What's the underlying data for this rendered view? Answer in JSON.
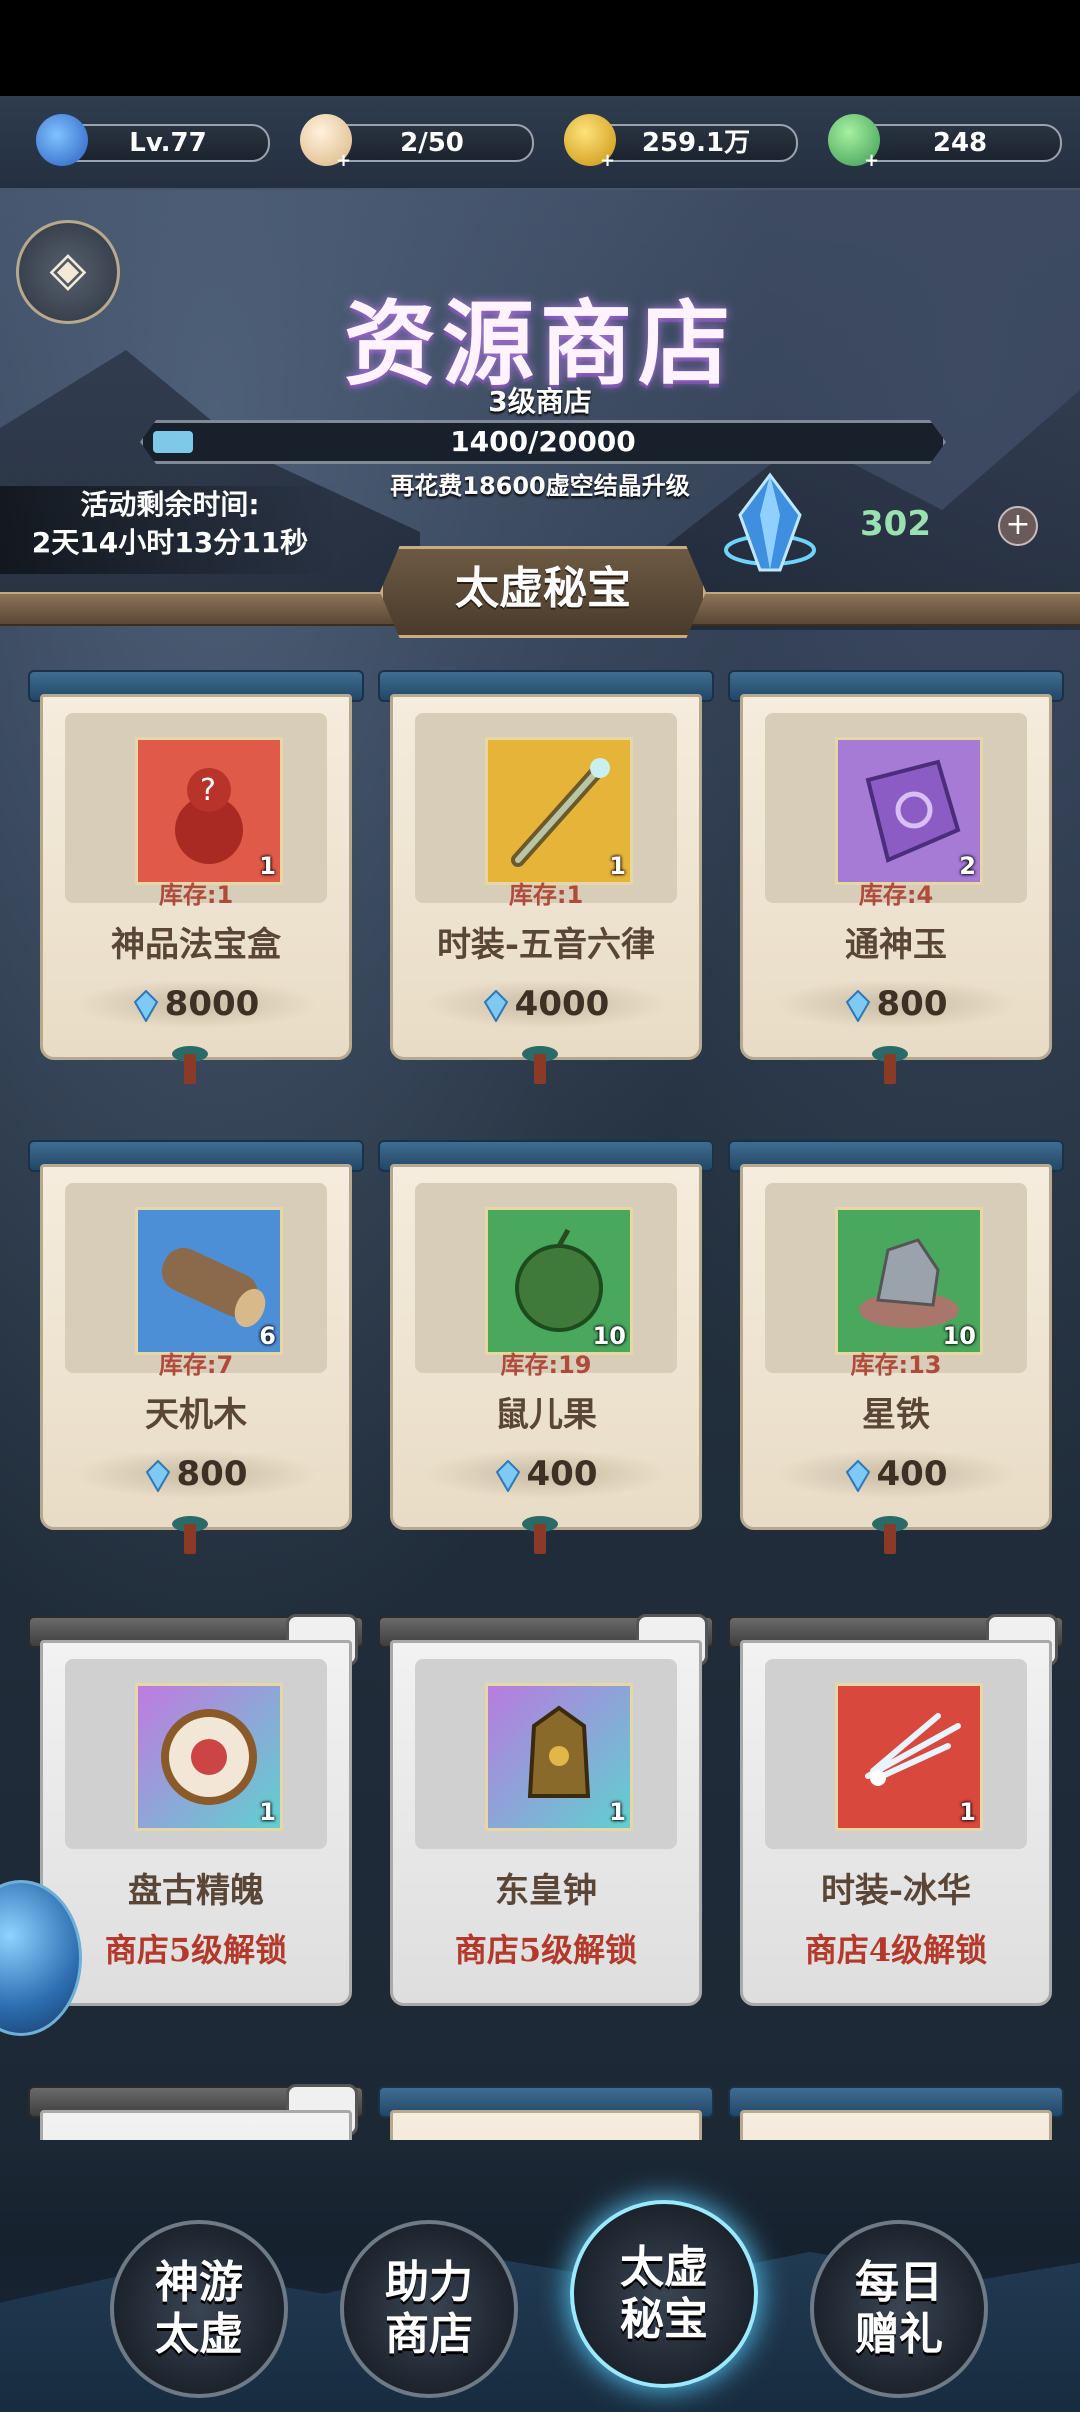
{
  "resources": [
    {
      "icon": "level-swirl-icon",
      "value": "Lv.77",
      "color": "#3a7bd5",
      "plus": false
    },
    {
      "icon": "steamed-bun-icon",
      "value": "2/50",
      "color": "#e8c9a0",
      "plus": true
    },
    {
      "icon": "gold-coin-icon",
      "value": "259.1万",
      "color": "#d9a21a",
      "plus": true
    },
    {
      "icon": "green-leaf-icon",
      "value": "248",
      "color": "#4fb36a",
      "plus": true
    }
  ],
  "header": {
    "title": "资源商店",
    "level": "3级商店",
    "exp": "1400/20000",
    "exp_progress": 0.07,
    "upgrade_hint": "再花费18600虚空结晶升级",
    "timer_label": "活动剩余时间:",
    "timer_value": "2天14小时13分11秒",
    "currency_amount": "302",
    "currency_plus": "+",
    "section_tab": "太虚秘宝",
    "back_icon": "back-arrow-icon"
  },
  "items": [
    {
      "name": "神品法宝盒",
      "stock": "库存:1",
      "qty": "1",
      "price": "8000",
      "bg": "#e05a4a",
      "icon": "gourd-icon",
      "locked": false
    },
    {
      "name": "时装-五音六律",
      "stock": "库存:1",
      "qty": "1",
      "price": "4000",
      "bg": "#e7b43a",
      "icon": "flute-icon",
      "locked": false
    },
    {
      "name": "通神玉",
      "stock": "库存:4",
      "qty": "2",
      "price": "800",
      "bg": "#a57bd6",
      "icon": "jade-stone-icon",
      "locked": false
    },
    {
      "name": "天机木",
      "stock": "库存:7",
      "qty": "6",
      "price": "800",
      "bg": "#4d8fd6",
      "icon": "wood-log-icon",
      "locked": false
    },
    {
      "name": "鼠儿果",
      "stock": "库存:19",
      "qty": "10",
      "price": "400",
      "bg": "#49a85e",
      "icon": "green-fruit-icon",
      "locked": false
    },
    {
      "name": "星铁",
      "stock": "库存:13",
      "qty": "10",
      "price": "400",
      "bg": "#49a85e",
      "icon": "star-iron-ore-icon",
      "locked": false
    },
    {
      "name": "盘古精魄",
      "qty": "1",
      "unlock": "商店5级解锁",
      "bg": "#c07ae0",
      "icon": "pangu-spirit-icon",
      "locked": true
    },
    {
      "name": "东皇钟",
      "qty": "1",
      "unlock": "商店5级解锁",
      "bg": "#b87be0",
      "icon": "bell-icon",
      "locked": true
    },
    {
      "name": "时装-冰华",
      "qty": "1",
      "unlock": "商店4级解锁",
      "bg": "#d9483d",
      "icon": "ice-feather-icon",
      "locked": true
    }
  ],
  "nav": [
    {
      "label_line1": "神游",
      "label_line2": "太虚",
      "active": false
    },
    {
      "label_line1": "助力",
      "label_line2": "商店",
      "active": false
    },
    {
      "label_line1": "太虚",
      "label_line2": "秘宝",
      "active": true
    },
    {
      "label_line1": "每日",
      "label_line2": "赠礼",
      "active": false
    }
  ]
}
